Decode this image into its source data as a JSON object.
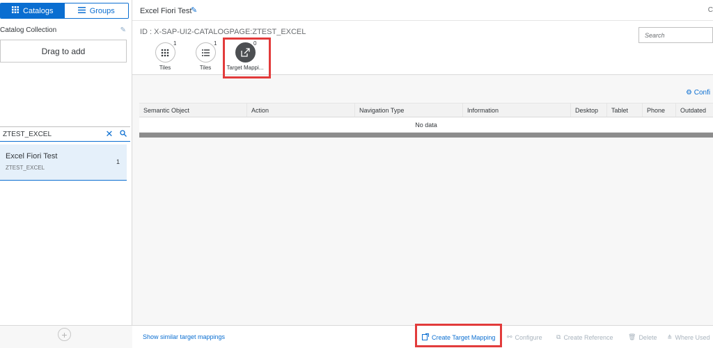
{
  "left": {
    "tabs": [
      {
        "label": "Catalogs",
        "icon": "grid-icon",
        "active": true
      },
      {
        "label": "Groups",
        "icon": "menu-icon",
        "active": false
      }
    ],
    "catalog_collection_label": "Catalog Collection",
    "drag_to_add": "Drag to add",
    "search_value": "ZTEST_EXCEL",
    "catalog_item": {
      "title": "Excel Fiori Test",
      "subtitle": "ZTEST_EXCEL",
      "count": "1"
    }
  },
  "header": {
    "title": "Excel Fiori Test",
    "right_glyph": "C"
  },
  "idbar": {
    "id_text": "ID : X-SAP-UI2-CATALOGPAGE:ZTEST_EXCEL",
    "search_placeholder": "Search",
    "tiles": [
      {
        "label": "Tiles",
        "count": "1",
        "icon": "grid-icon"
      },
      {
        "label": "Tiles",
        "count": "1",
        "icon": "list-icon"
      },
      {
        "label": "Target Mappi...",
        "count": "0",
        "icon": "share-icon"
      }
    ]
  },
  "table": {
    "configure_label": "Confi",
    "columns": [
      "Semantic Object",
      "Action",
      "Navigation Type",
      "Information",
      "Desktop",
      "Tablet",
      "Phone",
      "Outdated"
    ],
    "no_data": "No data"
  },
  "footer": {
    "show_similar": "Show similar target mappings",
    "create_target_mapping": "Create Target Mapping",
    "configure": "Configure",
    "create_reference": "Create Reference",
    "delete": "Delete",
    "where_used": "Where Used"
  },
  "colors": {
    "accent": "#0a6ed1",
    "highlight": "#e23b3b"
  }
}
